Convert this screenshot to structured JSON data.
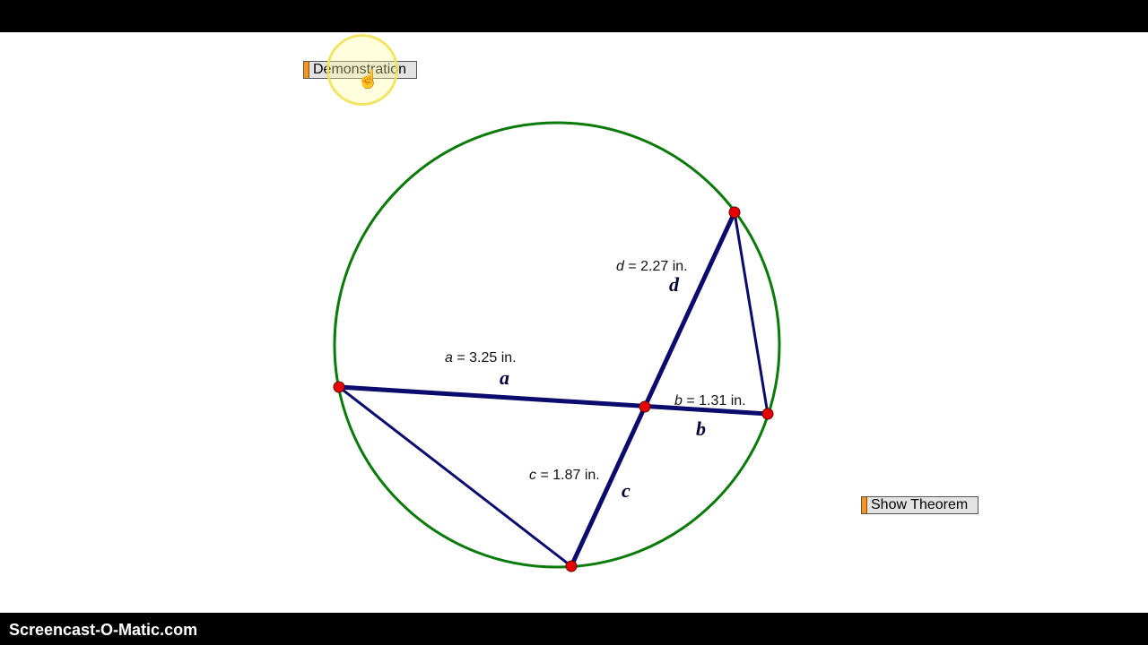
{
  "toolbar": {
    "demonstration_label": "Demonstration",
    "show_theorem_label": "Show Theorem"
  },
  "cursor": {
    "icon": "hand-pointer-icon"
  },
  "diagram": {
    "circle_color": "#0a7a0a",
    "segment_color": "#0b0b6e",
    "point_color": "#e60000",
    "measurements": [
      {
        "id": "a",
        "var": "a",
        "text": " = 3.25 in."
      },
      {
        "id": "b",
        "var": "b",
        "text": " = 1.31 in."
      },
      {
        "id": "c",
        "var": "c",
        "text": " = 1.87 in."
      },
      {
        "id": "d",
        "var": "d",
        "text": " = 2.27 in."
      }
    ],
    "segment_labels": {
      "a": "a",
      "b": "b",
      "c": "c",
      "d": "d"
    }
  },
  "footer": {
    "watermark": "Screencast-O-Matic.com"
  }
}
